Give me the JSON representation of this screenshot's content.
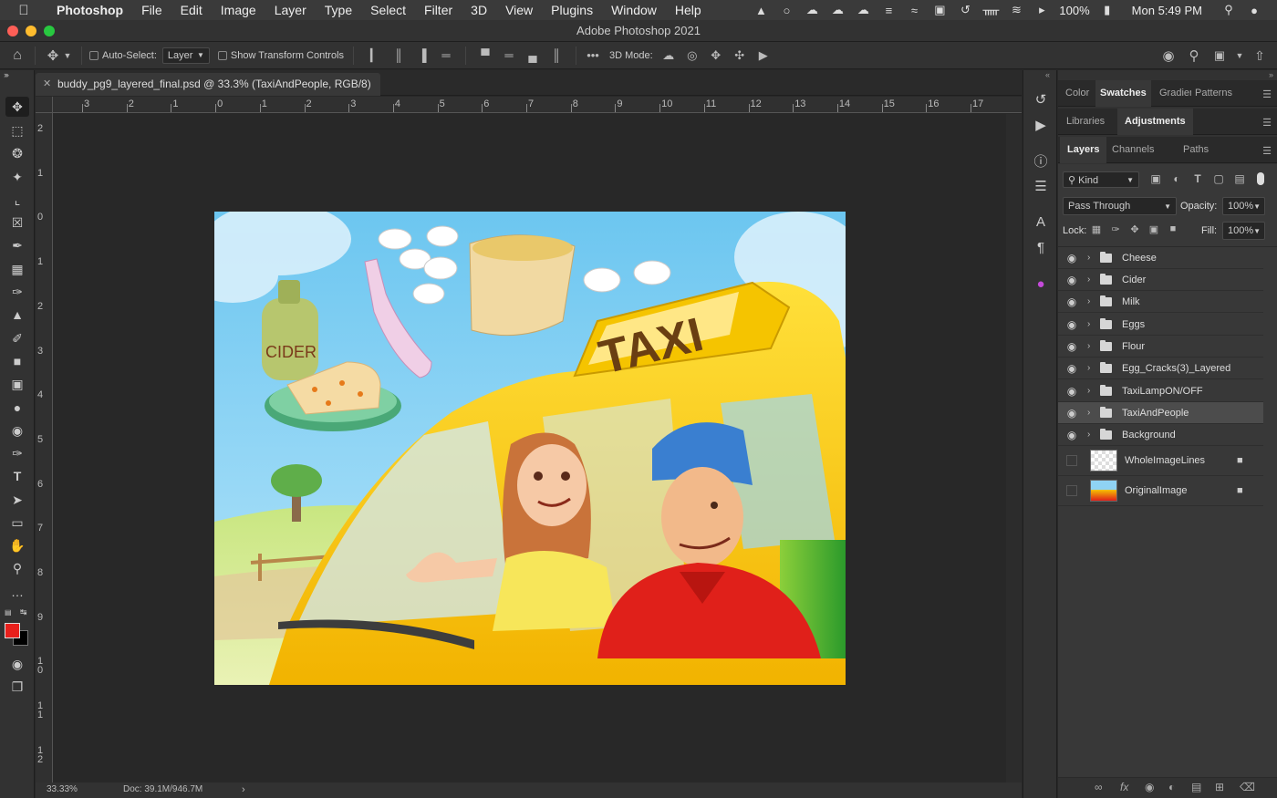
{
  "menubar": {
    "app": "Photoshop",
    "items": [
      "File",
      "Edit",
      "Image",
      "Layer",
      "Type",
      "Select",
      "Filter",
      "3D",
      "View",
      "Plugins",
      "Window",
      "Help"
    ],
    "battery": "100%",
    "clock": "Mon 5:49 PM"
  },
  "titlebar": {
    "title": "Adobe Photoshop 2021"
  },
  "options": {
    "auto_select_label": "Auto-Select:",
    "auto_select_value": "Layer",
    "transform_label": "Show Transform Controls",
    "mode3d_label": "3D Mode:",
    "more": "•••"
  },
  "document": {
    "tab_title": "buddy_pg9_layered_final.psd @ 33.3% (TaxiAndPeople, RGB/8)",
    "zoom": "33.33%",
    "doc_size": "Doc: 39.1M/946.7M"
  },
  "rulers": {
    "top": [
      "3",
      "2",
      "1",
      "0",
      "1",
      "2",
      "3",
      "4",
      "5",
      "6",
      "7",
      "8",
      "9",
      "10",
      "11",
      "12",
      "13",
      "14",
      "15",
      "16",
      "17"
    ],
    "left": [
      "2",
      "1",
      "0",
      "1",
      "2",
      "3",
      "4",
      "5",
      "6",
      "7",
      "8",
      "9",
      "10",
      "11",
      "12"
    ]
  },
  "artwork": {
    "sign_text": "TAXI",
    "jug_label": "CIDER"
  },
  "panels": {
    "top_tabs": [
      "Color",
      "Swatches",
      "Gradient",
      "Patterns"
    ],
    "mid_tabs": [
      "Libraries",
      "Adjustments"
    ],
    "layer_tabs": [
      "Layers",
      "Channels",
      "Paths"
    ],
    "filter_kind": "Kind",
    "blend_mode": "Pass Through",
    "opacity_label": "Opacity:",
    "opacity_value": "100%",
    "lock_label": "Lock:",
    "fill_label": "Fill:",
    "fill_value": "100%"
  },
  "layers": {
    "groups": [
      "Cheese",
      "Cider",
      "Milk",
      "Eggs",
      "Flour",
      "Egg_Cracks(3)_Layered",
      "TaxiLampON/OFF",
      "TaxiAndPeople",
      "Background"
    ],
    "selected": "TaxiAndPeople",
    "image_layers": [
      "WholeImageLines",
      "OriginalImage"
    ]
  },
  "colors": {
    "foreground": "#e8201c",
    "background": "#000000",
    "taxi_yellow": "#f5c400",
    "sky": "#8fd3f4"
  }
}
